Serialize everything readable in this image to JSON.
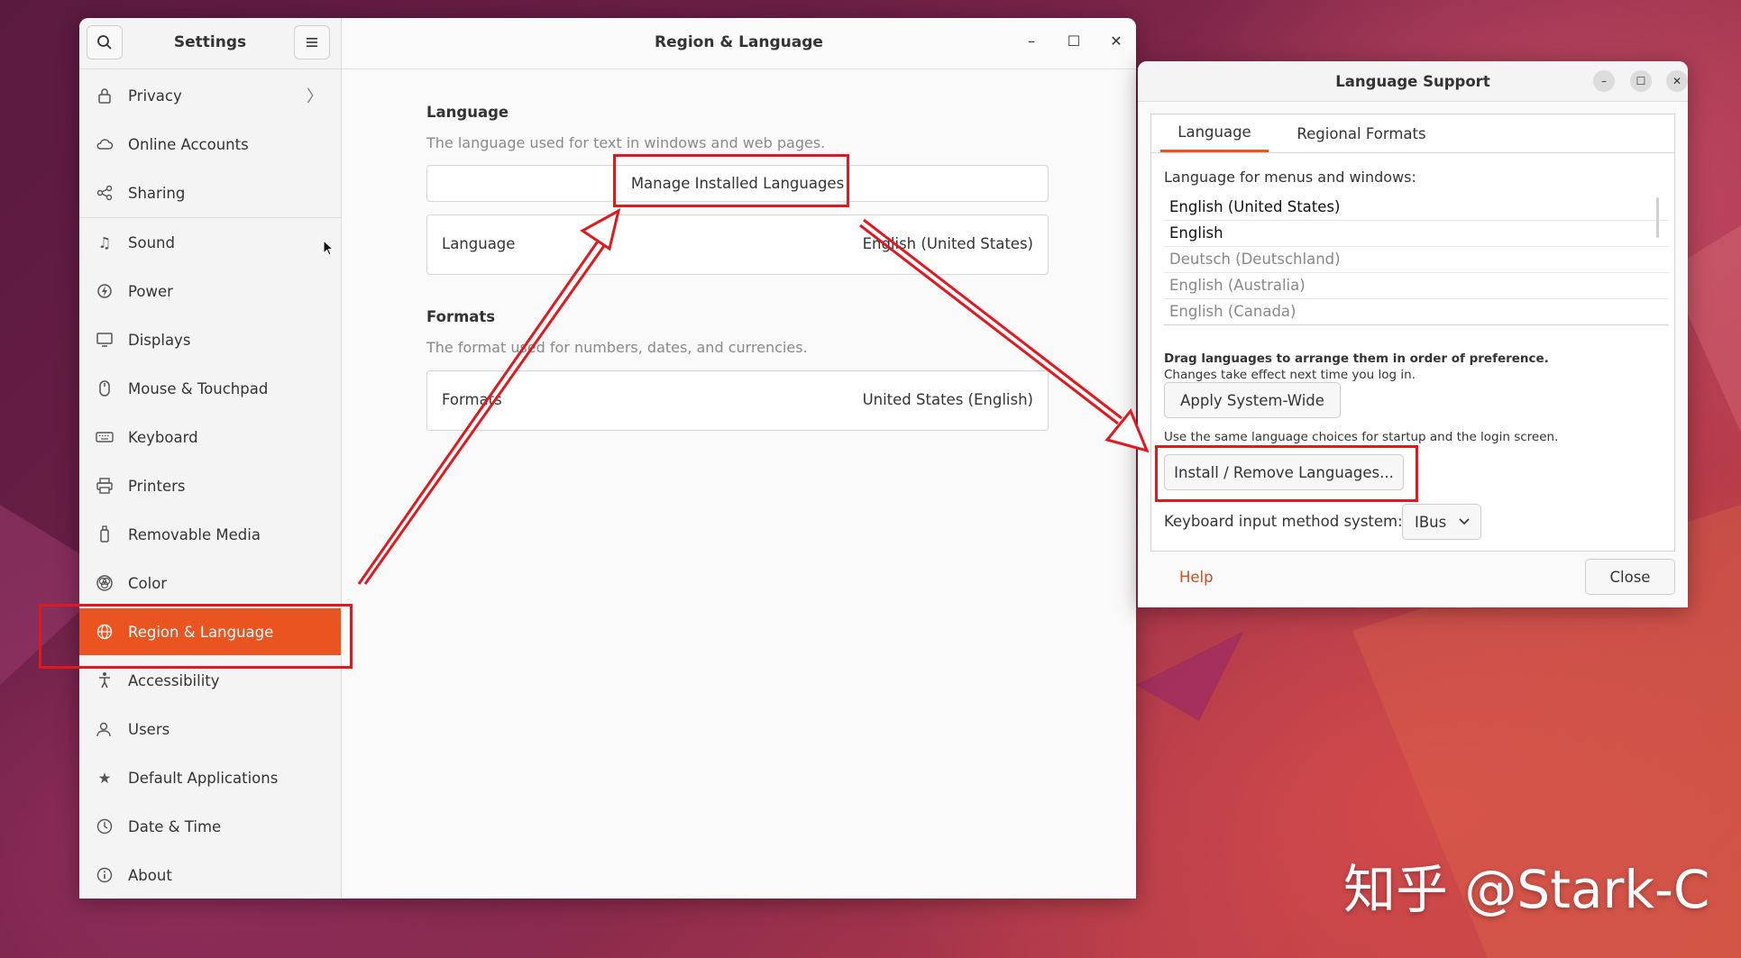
{
  "settings": {
    "sidebar_title": "Settings",
    "nav": [
      {
        "label": "Privacy",
        "icon": "lock-icon"
      },
      {
        "label": "Online Accounts",
        "icon": "cloud-icon"
      },
      {
        "label": "Sharing",
        "icon": "share-icon"
      },
      {
        "label": "Sound",
        "icon": "music-note-icon"
      },
      {
        "label": "Power",
        "icon": "power-icon"
      },
      {
        "label": "Displays",
        "icon": "display-icon"
      },
      {
        "label": "Mouse & Touchpad",
        "icon": "mouse-icon"
      },
      {
        "label": "Keyboard",
        "icon": "keyboard-icon"
      },
      {
        "label": "Printers",
        "icon": "printer-icon"
      },
      {
        "label": "Removable Media",
        "icon": "usb-icon"
      },
      {
        "label": "Color",
        "icon": "color-icon"
      },
      {
        "label": "Region & Language",
        "icon": "globe-icon",
        "active": true
      },
      {
        "label": "Accessibility",
        "icon": "accessibility-icon"
      },
      {
        "label": "Users",
        "icon": "users-icon"
      },
      {
        "label": "Default Applications",
        "icon": "star-icon"
      },
      {
        "label": "Date & Time",
        "icon": "clock-icon"
      },
      {
        "label": "About",
        "icon": "info-icon"
      }
    ],
    "main_title": "Region & Language",
    "language_section": {
      "title": "Language",
      "description": "The language used for text in windows and web pages.",
      "manage_button": "Manage Installed Languages",
      "row_label": "Language",
      "row_value": "English (United States)"
    },
    "formats_section": {
      "title": "Formats",
      "description": "The format used for numbers, dates, and currencies.",
      "row_label": "Formats",
      "row_value": "United States (English)"
    }
  },
  "language_support": {
    "title": "Language Support",
    "tabs": [
      "Language",
      "Regional Formats"
    ],
    "menus_label": "Language for menus and windows:",
    "languages": [
      {
        "label": "English (United States)",
        "active": true
      },
      {
        "label": "English",
        "active": true
      },
      {
        "label": "Deutsch (Deutschland)",
        "active": false
      },
      {
        "label": "English (Australia)",
        "active": false
      },
      {
        "label": "English (Canada)",
        "active": false
      }
    ],
    "drag_hint_bold": "Drag languages to arrange them in order of preference.",
    "drag_hint": "Changes take effect next time you log in.",
    "apply_button": "Apply System-Wide",
    "apply_hint": "Use the same language choices for startup and the login screen.",
    "install_button": "Install / Remove Languages...",
    "input_method_label": "Keyboard input method system:",
    "input_method_value": "IBus",
    "help_label": "Help",
    "close_label": "Close"
  },
  "watermark": "知乎 @Stark-C",
  "colors": {
    "accent": "#e95420",
    "highlight_box": "#e0191f"
  }
}
